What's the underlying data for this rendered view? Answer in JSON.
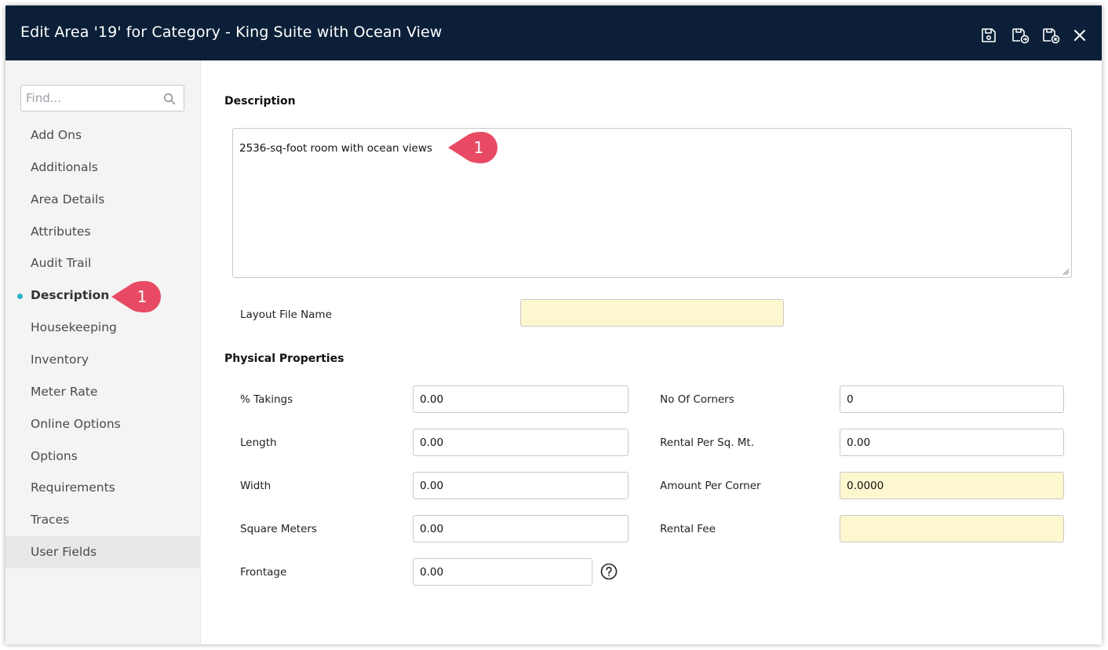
{
  "window": {
    "title": "Edit Area '19' for Category - King Suite with Ocean View",
    "title_bg": "#0b2038",
    "toolbar_icons": [
      "save-icon",
      "save-and-new-icon",
      "save-and-close-icon",
      "close-icon"
    ]
  },
  "sidebar": {
    "find_placeholder": "Find...",
    "accent": "#2ab0c9",
    "items": [
      {
        "label": "Add Ons"
      },
      {
        "label": "Additionals"
      },
      {
        "label": "Area Details"
      },
      {
        "label": "Attributes"
      },
      {
        "label": "Audit Trail"
      },
      {
        "label": "Description",
        "active": true
      },
      {
        "label": "Housekeeping"
      },
      {
        "label": "Inventory"
      },
      {
        "label": "Meter Rate"
      },
      {
        "label": "Online Options"
      },
      {
        "label": "Options"
      },
      {
        "label": "Requirements"
      },
      {
        "label": "Traces"
      },
      {
        "label": "User Fields",
        "hover": true
      }
    ]
  },
  "callouts": {
    "color": "#e84a64",
    "sidebar_badge": "1",
    "description_badge": "1"
  },
  "description": {
    "title": "Description",
    "text": "2536-sq-foot room with ocean views",
    "layout_file_label": "Layout File Name",
    "layout_file_value": ""
  },
  "physical": {
    "title": "Physical Properties",
    "takings": {
      "label": "% Takings",
      "value": "0.00"
    },
    "length": {
      "label": "Length",
      "value": "0.00"
    },
    "width": {
      "label": "Width",
      "value": "0.00"
    },
    "square_meters": {
      "label": "Square Meters",
      "value": "0.00"
    },
    "frontage": {
      "label": "Frontage",
      "value": "0.00"
    },
    "corners": {
      "label": "No Of Corners",
      "value": "0"
    },
    "rental_per_sqm": {
      "label": "Rental Per Sq. Mt.",
      "value": "0.00"
    },
    "amount_per_corner": {
      "label": "Amount Per Corner",
      "value": "0.0000"
    },
    "rental_fee": {
      "label": "Rental Fee",
      "value": ""
    }
  },
  "colors": {
    "readonly_field": "#fdf7cf"
  }
}
